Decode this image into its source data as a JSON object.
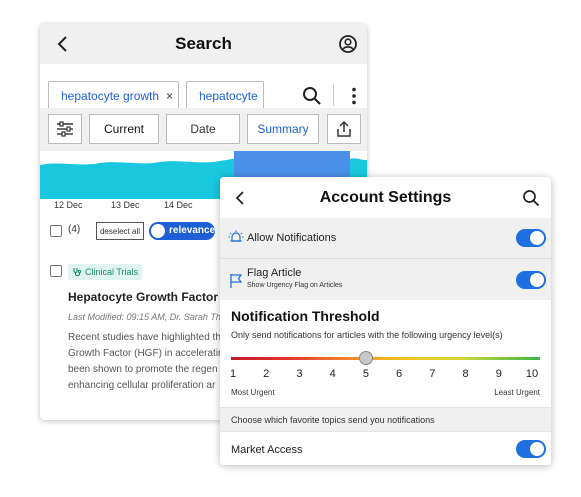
{
  "search_panel": {
    "title": "Search",
    "chips": [
      {
        "label": "hepatocyte growth",
        "remove": "×"
      },
      {
        "label": "hepatocyte"
      }
    ],
    "filters": {
      "current": "Current",
      "date": "Date",
      "summary": "Summary"
    },
    "timeline_labels": [
      "12 Dec",
      "13 Dec",
      "14 Dec"
    ],
    "selection": {
      "count": "(4)",
      "deselect_all": "deselect all",
      "sort_toggle": "relevance"
    },
    "article": {
      "tag": "Clinical Trials",
      "title": "Hepatocyte Growth Factor in",
      "meta": "Last Modified: 09:15 AM, Dr. Sarah Tho",
      "body_lines": [
        "Recent studies have highlighted th",
        "Growth Factor (HGF) in acceleratin",
        "been shown to promote the regen",
        "enhancing cellular proliferation ar"
      ]
    }
  },
  "account_settings": {
    "title": "Account Settings",
    "allow_notifications": {
      "label": "Allow Notifications",
      "on": true
    },
    "flag_article": {
      "label": "Flag Article",
      "sub": "Show Urgency Flag on Articles",
      "on": true
    },
    "threshold": {
      "title": "Notification Threshold",
      "description": "Only send notifications for articles with the following urgency level(s)",
      "scale": [
        "1",
        "2",
        "3",
        "4",
        "5",
        "6",
        "7",
        "8",
        "9",
        "10"
      ],
      "selected_level": 5,
      "min_label": "Most Urgent",
      "max_label": "Least Urgent"
    },
    "topics_header": "Choose which favorite topics send you notifications",
    "topics": [
      {
        "label": "Market Access",
        "on": true
      }
    ]
  },
  "colors": {
    "accent_blue": "#1f5fd6",
    "toggle_blue": "#1f6fe0",
    "timeline_cyan": "#19c7df",
    "timeline_highlight": "#4a90e8",
    "tag_green": "#1b8a6b"
  }
}
